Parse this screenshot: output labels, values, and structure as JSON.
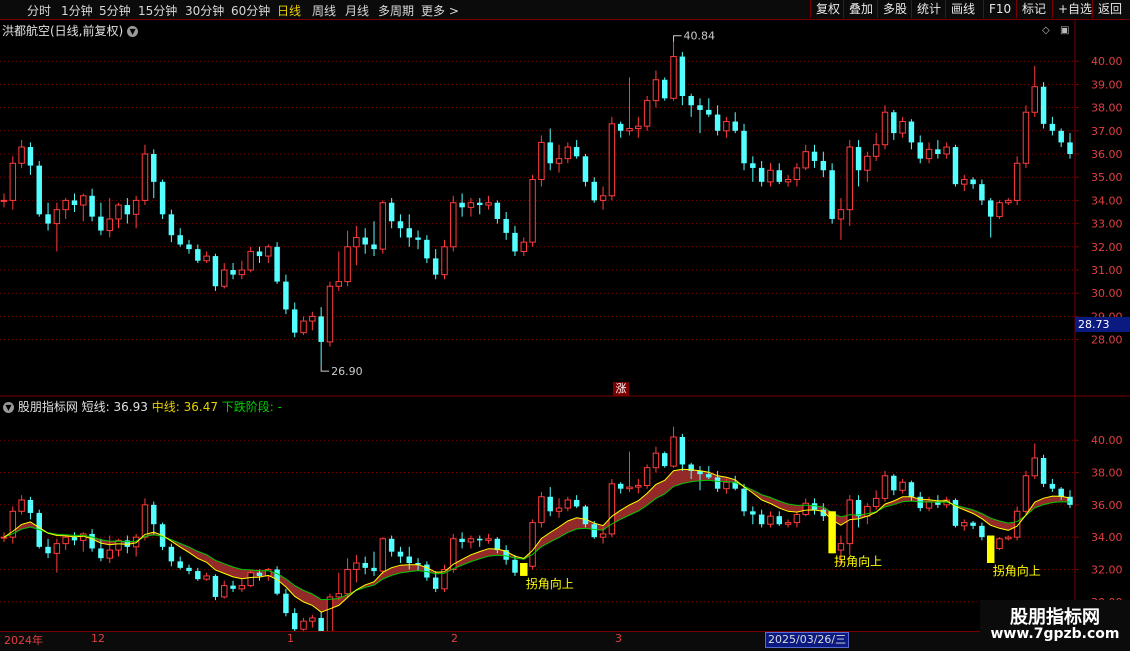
{
  "toolbar": {
    "periods": [
      "分时",
      "1分钟",
      "5分钟",
      "15分钟",
      "30分钟",
      "60分钟",
      "日线",
      "周线",
      "月线",
      "多周期",
      "更多 >"
    ],
    "active_period": "日线",
    "right_buttons": [
      "复权",
      "叠加",
      "多股",
      "统计",
      "画线",
      "F10",
      "标记",
      "+自选",
      "返回"
    ]
  },
  "main_panel": {
    "title": "洪都航空(日线,前复权)",
    "last_price": "28.73",
    "high_label": "40.84",
    "low_label": "26.90",
    "signal_badge": "涨",
    "icons": [
      "diamond-icon",
      "window-icon"
    ]
  },
  "indicator_panel": {
    "name": "股朋指标网",
    "short_label": "短线:",
    "short_value": "36.93",
    "mid_label": "中线:",
    "mid_value": "36.47",
    "phase_label": "下跌阶段:",
    "phase_value": "-",
    "signal_text": "拐角向上"
  },
  "time_axis": {
    "year_label": "2024年",
    "month_labels": [
      "12",
      "1",
      "2",
      "3"
    ],
    "cursor_date": "2025/03/26/三"
  },
  "watermark": {
    "line1": "股朋指标网",
    "line2": "www.7gpzb.com"
  },
  "colors": {
    "up": "#ff3c3c",
    "down": "#54ffff",
    "short_line": "#ffff00",
    "mid_line": "#00c800",
    "band": "#9c2b2b",
    "signal_bar": "#ffff00",
    "grid": "#7a0000",
    "axis_text": "#e04040"
  },
  "chart_data": [
    {
      "type": "candlestick",
      "panel": "main",
      "ylim": [
        26.0,
        41.0
      ],
      "yticks": [
        "40.00",
        "39.00",
        "38.00",
        "37.00",
        "36.00",
        "35.00",
        "34.00",
        "33.00",
        "32.00",
        "31.00",
        "30.00",
        "29.00",
        "28.00"
      ],
      "candles": [
        [
          34.0,
          34.3,
          33.7,
          34.0
        ],
        [
          34.0,
          35.9,
          33.6,
          35.6
        ],
        [
          35.6,
          36.6,
          35.4,
          36.3
        ],
        [
          36.3,
          36.5,
          35.1,
          35.5
        ],
        [
          35.5,
          35.7,
          33.3,
          33.4
        ],
        [
          33.4,
          33.9,
          32.7,
          33.0
        ],
        [
          33.0,
          33.9,
          31.8,
          33.6
        ],
        [
          33.6,
          34.1,
          33.2,
          34.0
        ],
        [
          34.0,
          34.3,
          33.5,
          33.8
        ],
        [
          33.8,
          34.3,
          33.1,
          34.2
        ],
        [
          34.2,
          34.5,
          33.1,
          33.3
        ],
        [
          33.3,
          33.9,
          32.5,
          32.7
        ],
        [
          32.7,
          34.1,
          32.4,
          33.2
        ],
        [
          33.2,
          33.9,
          32.8,
          33.8
        ],
        [
          33.8,
          34.1,
          33.0,
          33.4
        ],
        [
          33.4,
          34.2,
          32.8,
          34.0
        ],
        [
          34.0,
          36.4,
          33.8,
          36.0
        ],
        [
          36.0,
          36.2,
          34.1,
          34.8
        ],
        [
          34.8,
          34.9,
          33.2,
          33.4
        ],
        [
          33.4,
          33.6,
          32.2,
          32.5
        ],
        [
          32.5,
          32.8,
          32.0,
          32.1
        ],
        [
          32.1,
          32.3,
          31.7,
          31.9
        ],
        [
          31.9,
          32.1,
          31.3,
          31.4
        ],
        [
          31.4,
          31.8,
          31.3,
          31.6
        ],
        [
          31.6,
          31.7,
          30.1,
          30.3
        ],
        [
          30.3,
          31.3,
          30.2,
          31.0
        ],
        [
          31.0,
          31.3,
          30.6,
          30.8
        ],
        [
          30.8,
          31.4,
          30.6,
          31.0
        ],
        [
          31.0,
          32.0,
          30.9,
          31.8
        ],
        [
          31.8,
          32.0,
          31.3,
          31.6
        ],
        [
          31.6,
          32.1,
          31.3,
          32.0
        ],
        [
          32.0,
          32.2,
          30.4,
          30.5
        ],
        [
          30.5,
          30.8,
          29.1,
          29.3
        ],
        [
          29.3,
          29.6,
          28.1,
          28.3
        ],
        [
          28.3,
          29.0,
          28.2,
          28.8
        ],
        [
          28.8,
          29.2,
          28.4,
          29.0
        ],
        [
          29.0,
          29.4,
          26.9,
          27.9
        ],
        [
          27.9,
          30.5,
          27.7,
          30.3
        ],
        [
          30.3,
          31.8,
          30.1,
          30.5
        ],
        [
          30.5,
          32.7,
          30.3,
          32.0
        ],
        [
          32.0,
          32.9,
          31.2,
          32.4
        ],
        [
          32.4,
          32.8,
          31.7,
          32.1
        ],
        [
          32.1,
          33.1,
          31.6,
          31.9
        ],
        [
          31.9,
          34.0,
          31.7,
          33.9
        ],
        [
          33.9,
          34.1,
          32.8,
          33.1
        ],
        [
          33.1,
          33.4,
          32.4,
          32.8
        ],
        [
          32.8,
          33.4,
          32.0,
          32.4
        ],
        [
          32.4,
          32.7,
          31.9,
          32.3
        ],
        [
          32.3,
          32.5,
          31.3,
          31.5
        ],
        [
          31.5,
          31.9,
          30.6,
          30.8
        ],
        [
          30.8,
          32.3,
          30.6,
          32.0
        ],
        [
          32.0,
          34.2,
          31.8,
          33.9
        ],
        [
          33.9,
          34.3,
          33.3,
          33.7
        ],
        [
          33.7,
          34.1,
          33.3,
          33.9
        ],
        [
          33.9,
          34.1,
          33.4,
          33.8
        ],
        [
          33.8,
          34.2,
          33.6,
          33.9
        ],
        [
          33.9,
          34.0,
          33.0,
          33.2
        ],
        [
          33.2,
          33.5,
          32.3,
          32.6
        ],
        [
          32.6,
          32.9,
          31.6,
          31.8
        ],
        [
          31.8,
          32.4,
          31.6,
          32.2
        ],
        [
          32.2,
          35.1,
          32.0,
          34.9
        ],
        [
          34.9,
          36.8,
          34.6,
          36.5
        ],
        [
          36.5,
          37.1,
          35.3,
          35.6
        ],
        [
          35.6,
          36.4,
          35.2,
          35.8
        ],
        [
          35.8,
          36.5,
          35.6,
          36.3
        ],
        [
          36.3,
          36.6,
          35.8,
          35.9
        ],
        [
          35.9,
          36.0,
          34.6,
          34.8
        ],
        [
          34.8,
          35.0,
          33.9,
          34.0
        ],
        [
          34.0,
          34.6,
          33.6,
          34.2
        ],
        [
          34.2,
          37.6,
          34.0,
          37.3
        ],
        [
          37.3,
          37.4,
          36.7,
          37.0
        ],
        [
          37.0,
          39.3,
          36.8,
          37.1
        ],
        [
          37.1,
          37.6,
          36.7,
          37.2
        ],
        [
          37.2,
          38.5,
          37.0,
          38.3
        ],
        [
          38.3,
          39.6,
          38.0,
          39.2
        ],
        [
          39.2,
          39.3,
          38.3,
          38.4
        ],
        [
          38.4,
          40.84,
          38.3,
          40.2
        ],
        [
          40.2,
          40.4,
          38.1,
          38.5
        ],
        [
          38.5,
          38.6,
          37.6,
          38.1
        ],
        [
          38.1,
          38.4,
          36.9,
          37.9
        ],
        [
          37.9,
          38.4,
          37.6,
          37.7
        ],
        [
          37.7,
          38.1,
          36.8,
          37.0
        ],
        [
          37.0,
          37.6,
          36.7,
          37.4
        ],
        [
          37.4,
          37.8,
          36.9,
          37.0
        ],
        [
          37.0,
          37.3,
          35.3,
          35.6
        ],
        [
          35.6,
          35.9,
          34.8,
          35.4
        ],
        [
          35.4,
          35.7,
          34.6,
          34.8
        ],
        [
          34.8,
          35.6,
          34.6,
          35.3
        ],
        [
          35.3,
          35.6,
          34.7,
          34.8
        ],
        [
          34.8,
          35.1,
          34.6,
          34.9
        ],
        [
          34.9,
          35.6,
          34.6,
          35.4
        ],
        [
          35.4,
          36.4,
          35.3,
          36.1
        ],
        [
          36.1,
          36.4,
          35.4,
          35.7
        ],
        [
          35.7,
          36.1,
          35.0,
          35.3
        ],
        [
          35.3,
          35.6,
          33.0,
          33.2
        ],
        [
          33.2,
          34.1,
          32.3,
          33.6
        ],
        [
          33.6,
          36.6,
          32.9,
          36.3
        ],
        [
          36.3,
          36.6,
          34.6,
          35.3
        ],
        [
          35.3,
          36.1,
          34.8,
          35.9
        ],
        [
          35.9,
          36.9,
          35.7,
          36.4
        ],
        [
          36.4,
          38.1,
          36.2,
          37.8
        ],
        [
          37.8,
          37.9,
          36.6,
          36.9
        ],
        [
          36.9,
          37.6,
          36.7,
          37.4
        ],
        [
          37.4,
          37.5,
          36.2,
          36.5
        ],
        [
          36.5,
          36.8,
          35.6,
          35.8
        ],
        [
          35.8,
          36.5,
          35.6,
          36.2
        ],
        [
          36.2,
          36.6,
          35.8,
          36.0
        ],
        [
          36.0,
          36.5,
          35.8,
          36.3
        ],
        [
          36.3,
          36.4,
          34.6,
          34.7
        ],
        [
          34.7,
          35.1,
          34.4,
          34.9
        ],
        [
          34.9,
          35.0,
          34.5,
          34.7
        ],
        [
          34.7,
          34.9,
          33.8,
          34.0
        ],
        [
          34.0,
          34.1,
          32.4,
          33.3
        ],
        [
          33.3,
          34.0,
          33.2,
          33.9
        ],
        [
          33.9,
          34.1,
          33.8,
          34.0
        ],
        [
          34.0,
          35.9,
          33.8,
          35.6
        ],
        [
          35.6,
          38.1,
          35.4,
          37.8
        ],
        [
          37.8,
          39.8,
          37.6,
          38.9
        ],
        [
          38.9,
          39.1,
          37.1,
          37.3
        ],
        [
          37.3,
          37.6,
          36.8,
          37.0
        ],
        [
          37.0,
          37.1,
          36.3,
          36.5
        ],
        [
          36.5,
          36.9,
          35.8,
          36.0
        ]
      ]
    },
    {
      "type": "candlestick",
      "panel": "indicator",
      "ylim": [
        28.5,
        41.5
      ],
      "yticks": [
        "40.00",
        "38.00",
        "36.00",
        "34.00",
        "32.00",
        "30.00"
      ],
      "series": [
        {
          "name": "短线",
          "current": 36.93
        },
        {
          "name": "中线",
          "current": 36.47
        }
      ],
      "signals": [
        {
          "label": "拐角向上",
          "bar_index": 59
        },
        {
          "label": "拐角向上",
          "bar_index": 94
        },
        {
          "label": "拐角向上",
          "bar_index": 112
        }
      ]
    }
  ]
}
